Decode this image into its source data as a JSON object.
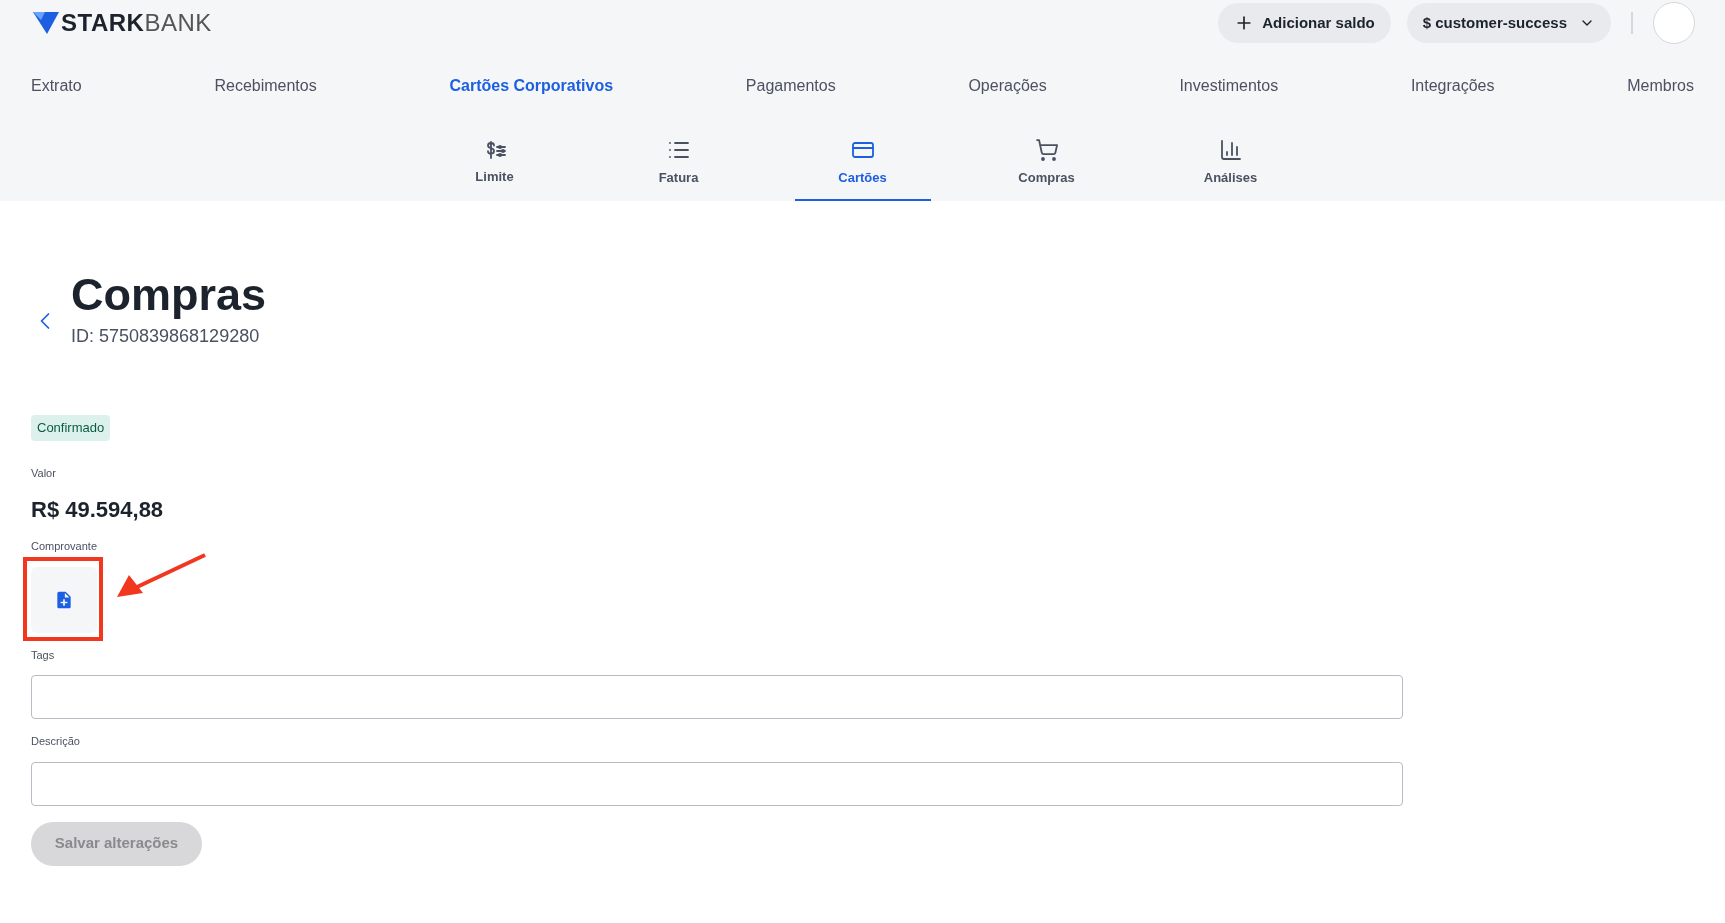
{
  "header": {
    "logo": {
      "bold": "STARK",
      "light": "BANK"
    },
    "add_button": "Adicionar saldo",
    "workspace_button": "$ customer-success"
  },
  "nav": [
    {
      "label": "Extrato",
      "selected": false
    },
    {
      "label": "Recebimentos",
      "selected": false
    },
    {
      "label": "Cartões Corporativos",
      "selected": true
    },
    {
      "label": "Pagamentos",
      "selected": false
    },
    {
      "label": "Operações",
      "selected": false
    },
    {
      "label": "Investimentos",
      "selected": false
    },
    {
      "label": "Integrações",
      "selected": false
    },
    {
      "label": "Membros",
      "selected": false
    }
  ],
  "subnav": [
    {
      "kind": "limit",
      "label": "Limite",
      "selected": false
    },
    {
      "kind": "invoice",
      "label": "Fatura",
      "selected": false
    },
    {
      "kind": "cards",
      "label": "Cartões",
      "selected": true
    },
    {
      "kind": "purchases",
      "label": "Compras",
      "selected": false
    },
    {
      "kind": "analytics",
      "label": "Análises",
      "selected": false
    }
  ],
  "page": {
    "title": "Compras",
    "id": "ID: 5750839868129280",
    "status": "Confirmado",
    "amount_label": "Valor",
    "amount": "R$ 49.594,88",
    "receipt_label": "Comprovante",
    "fields": [
      {
        "label": "Tags"
      },
      {
        "label": "Descrição"
      }
    ],
    "save_button": {
      "label": "Salvar alterações",
      "disabled": true
    }
  }
}
